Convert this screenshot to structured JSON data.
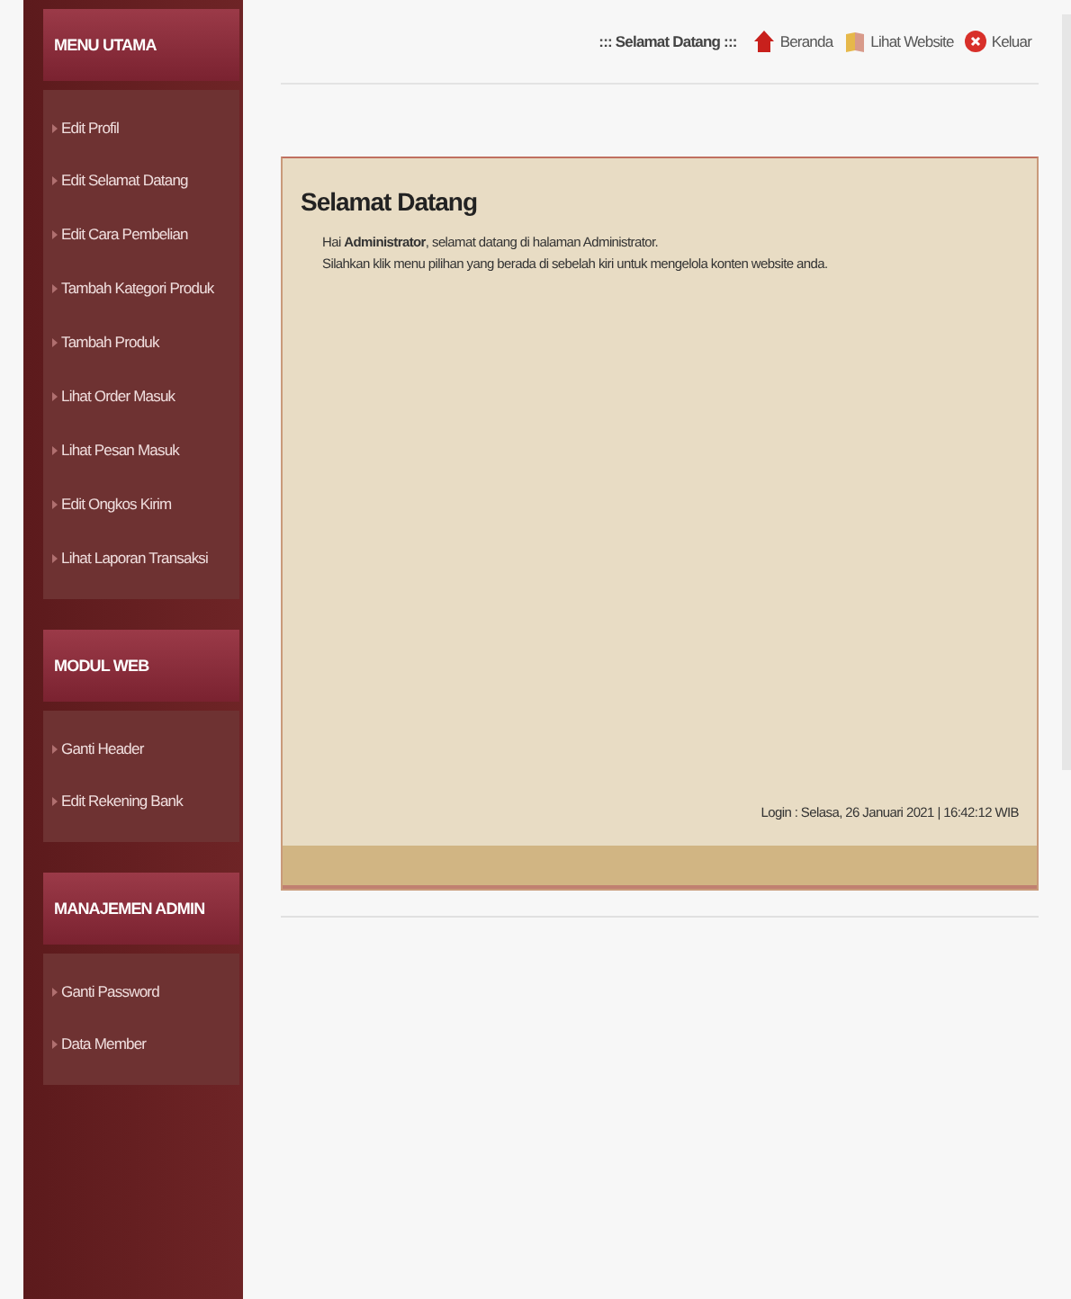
{
  "sidebar": {
    "sections": [
      {
        "title": "MENU UTAMA",
        "items": [
          "Edit Profil",
          "Edit Selamat Datang",
          "Edit Cara Pembelian",
          "Tambah Kategori Produk",
          "Tambah Produk",
          "Lihat Order Masuk",
          "Lihat Pesan Masuk",
          "Edit Ongkos Kirim",
          "Lihat Laporan Transaksi"
        ]
      },
      {
        "title": "MODUL WEB",
        "items": [
          "Ganti Header",
          "Edit Rekening Bank"
        ]
      },
      {
        "title": "MANAJEMEN ADMIN",
        "items": [
          "Ganti Password",
          "Data Member"
        ]
      }
    ]
  },
  "topbar": {
    "greeting": "::: Selamat Datang :::",
    "links": [
      {
        "kind": "home",
        "label": "Beranda"
      },
      {
        "kind": "website",
        "label": "Lihat Website"
      },
      {
        "kind": "logout",
        "label": "Keluar"
      }
    ]
  },
  "panel": {
    "title": "Selamat Datang",
    "lines": [
      "Hai **Administrator**, selamat datang di halaman Administrator.",
      "Silahkan klik menu pilihan yang berada di sebelah kiri untuk mengelola konten website anda."
    ],
    "login": "Login : Selasa, 26 Januari 2021 | 16:42:12 WIB"
  }
}
